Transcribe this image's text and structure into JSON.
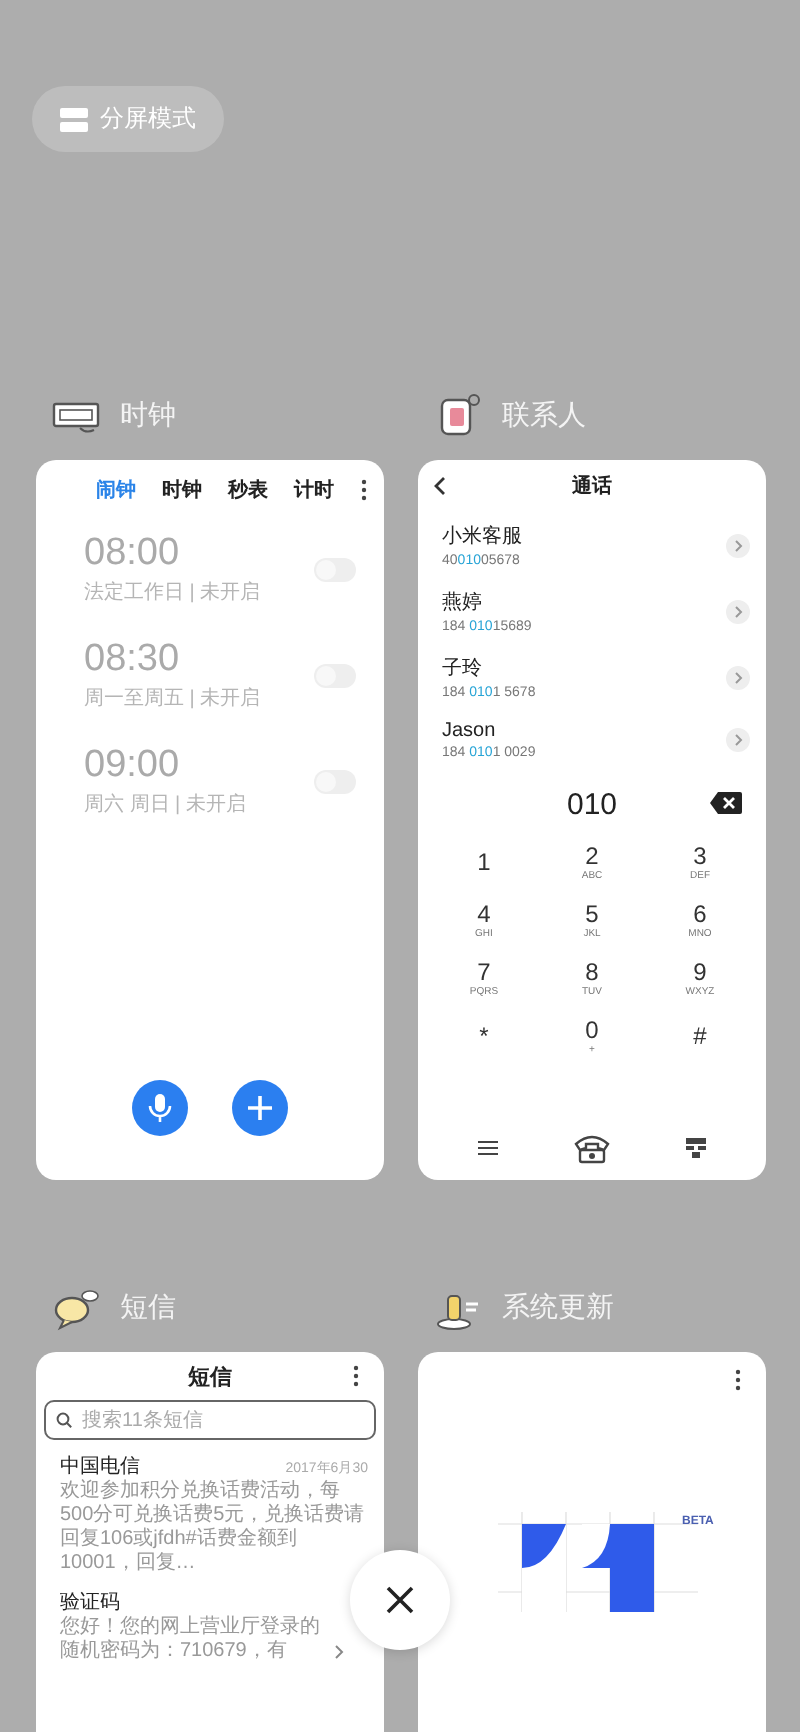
{
  "split_screen_button": {
    "label": "分屏模式"
  },
  "cards": [
    {
      "kind": "clock",
      "app_name": "时钟",
      "tabs": [
        {
          "label": "闹钟",
          "selected": true
        },
        {
          "label": "时钟",
          "selected": false
        },
        {
          "label": "秒表",
          "selected": false
        },
        {
          "label": "计时",
          "selected": false
        }
      ],
      "alarms": [
        {
          "time": "08:00",
          "repeat": "法定工作日 | 未开启",
          "on": false
        },
        {
          "time": "08:30",
          "repeat": "周一至周五 | 未开启",
          "on": false
        },
        {
          "time": "09:00",
          "repeat": "周六 周日 | 未开启",
          "on": false
        }
      ]
    },
    {
      "kind": "contacts",
      "app_name": "联系人",
      "title": "通话",
      "contacts": [
        {
          "name": "小米客服",
          "number_parts": [
            "40",
            "010",
            "05678"
          ]
        },
        {
          "name": "燕婷",
          "number_parts": [
            "184 ",
            "010",
            "15689"
          ]
        },
        {
          "name": "子玲",
          "number_parts": [
            "184 ",
            "010",
            "1 5678"
          ]
        },
        {
          "name": "Jason",
          "number_parts": [
            "184 ",
            "010",
            "1 0029"
          ]
        }
      ],
      "dialed": "010",
      "keys": [
        {
          "digit": "1"
        },
        {
          "digit": "2",
          "letters": "ABC"
        },
        {
          "digit": "3",
          "letters": "DEF"
        },
        {
          "digit": "4",
          "letters": "GHI"
        },
        {
          "digit": "5",
          "letters": "JKL"
        },
        {
          "digit": "6",
          "letters": "MNO"
        },
        {
          "digit": "7",
          "letters": "PQRS"
        },
        {
          "digit": "8",
          "letters": "TUV"
        },
        {
          "digit": "9",
          "letters": "WXYZ"
        },
        {
          "digit": "*"
        },
        {
          "digit": "0",
          "letters": "+"
        },
        {
          "digit": "#"
        }
      ]
    },
    {
      "kind": "messages",
      "app_name": "短信",
      "title": "短信",
      "search": {
        "placeholder": "搜索11条短信"
      },
      "messages": [
        {
          "sender": "中国电信",
          "date": "2017年6月30",
          "preview": "欢迎参加积分兑换话费活动，每500分可兑换话费5元，兑换话费请回复106或jfdh#话费金额到10001，回复…",
          "arrow": false
        },
        {
          "sender": "验证码",
          "preview": "您好！您的网上营业厅登录的随机密码为：710679，有",
          "arrow": true
        }
      ]
    },
    {
      "kind": "update",
      "app_name": "系统更新",
      "badge": "BETA"
    }
  ]
}
